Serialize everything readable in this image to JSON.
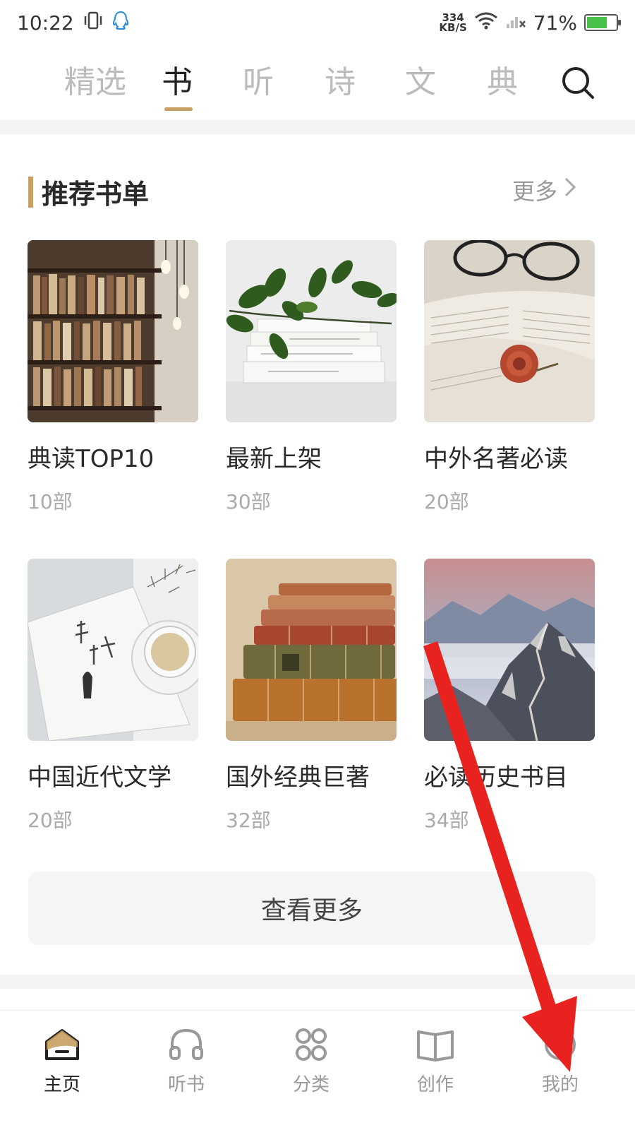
{
  "status_bar": {
    "time": "10:22",
    "net_speed_value": "334",
    "net_speed_unit": "KB/S",
    "battery_percent": "71%",
    "battery_level": 0.71
  },
  "top_tabs": [
    {
      "label": "精选",
      "active": false
    },
    {
      "label": "书",
      "active": true
    },
    {
      "label": "听",
      "active": false
    },
    {
      "label": "诗",
      "active": false
    },
    {
      "label": "文",
      "active": false
    },
    {
      "label": "典",
      "active": false
    }
  ],
  "section": {
    "title": "推荐书单",
    "more_label": "更多"
  },
  "book_lists": [
    {
      "name": "典读TOP10",
      "count": "10部",
      "image": "bookshelf-library-photo"
    },
    {
      "name": "最新上架",
      "count": "30部",
      "image": "plant-on-book-stack-photo"
    },
    {
      "name": "中外名著必读",
      "count": "20部",
      "image": "open-book-glasses-rose-photo"
    },
    {
      "name": "中国近代文学",
      "count": "20部",
      "image": "book-and-teacup-photo"
    },
    {
      "name": "国外经典巨著",
      "count": "32部",
      "image": "antique-books-stack-photo"
    },
    {
      "name": "必读历史书目",
      "count": "34部",
      "image": "great-wall-mountains-photo"
    }
  ],
  "view_more_label": "查看更多",
  "bottom_nav": [
    {
      "label": "主页",
      "icon": "home-icon",
      "active": true
    },
    {
      "label": "听书",
      "icon": "headphones-icon",
      "active": false
    },
    {
      "label": "分类",
      "icon": "grid-circles-icon",
      "active": false
    },
    {
      "label": "创作",
      "icon": "open-book-icon",
      "active": false
    },
    {
      "label": "我的",
      "icon": "profile-icon",
      "active": false
    }
  ],
  "colors": {
    "accent": "#c8a062",
    "annotation_arrow": "#e8231f"
  }
}
